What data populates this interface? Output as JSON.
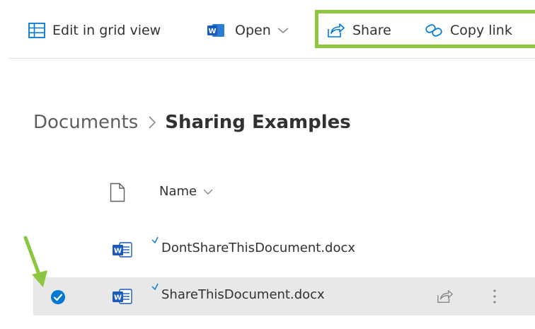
{
  "toolbar": {
    "edit_grid_label": "Edit in grid view",
    "open_label": "Open",
    "share_label": "Share",
    "copy_link_label": "Copy link"
  },
  "breadcrumb": {
    "root": "Documents",
    "separator": ">",
    "current": "Sharing Examples"
  },
  "list": {
    "column_name": "Name",
    "rows": [
      {
        "name": "DontShareThisDocument.docx",
        "selected": false
      },
      {
        "name": "ShareThisDocument.docx",
        "selected": true
      }
    ]
  },
  "colors": {
    "accent": "#0078d4",
    "highlight": "#8cc63f",
    "selected_row": "#e8e8e8",
    "word_blue": "#185abd"
  },
  "icons": {
    "grid": "grid-view-icon",
    "word": "word-icon",
    "share": "share-icon",
    "link": "link-icon",
    "check": "check-circle-icon",
    "more": "more-vertical-icon"
  }
}
